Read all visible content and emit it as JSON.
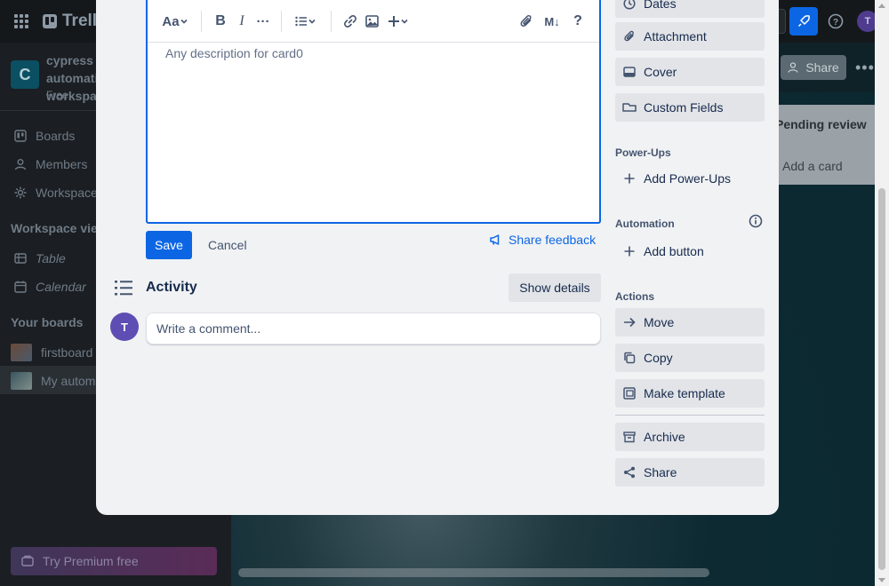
{
  "background": {
    "app_name": "Trello",
    "workspace": {
      "initial": "C",
      "name": "cypress automation workspace",
      "plan": "Free"
    },
    "nav": [
      {
        "label": "Boards",
        "icon": "board-icon"
      },
      {
        "label": "Members",
        "icon": "person-icon"
      },
      {
        "label": "Workspace settings",
        "icon": "gear-icon"
      }
    ],
    "workspace_views_heading": "Workspace views",
    "views": [
      {
        "label": "Table",
        "icon": "table-icon"
      },
      {
        "label": "Calendar",
        "icon": "calendar-icon"
      }
    ],
    "your_boards_heading": "Your boards",
    "boards": [
      {
        "label": "firstboard"
      },
      {
        "label": "My automation board"
      }
    ],
    "premium_label": "Try Premium free",
    "share_label": "Share",
    "list_title": "Pending review",
    "add_card_label": "Add a card",
    "user_initial": "T"
  },
  "card": {
    "description_text": "Any description for card0",
    "save_label": "Save",
    "cancel_label": "Cancel",
    "share_feedback_label": "Share feedback",
    "activity_title": "Activity",
    "show_details_label": "Show details",
    "comment_placeholder": "Write a comment...",
    "user_initial": "T"
  },
  "toolbar": {
    "text_style": "Aa",
    "bold": "B",
    "italic": "I",
    "more": "···",
    "markdown": "M↓",
    "help": "?"
  },
  "sidebar": {
    "add_to_card": [
      {
        "label": "Dates",
        "icon": "clock-icon"
      },
      {
        "label": "Attachment",
        "icon": "paperclip-icon"
      },
      {
        "label": "Cover",
        "icon": "cover-icon"
      },
      {
        "label": "Custom Fields",
        "icon": "custom-fields-icon"
      }
    ],
    "power_ups_heading": "Power-Ups",
    "add_power_ups_label": "Add Power-Ups",
    "automation_heading": "Automation",
    "add_button_label": "Add button",
    "actions_heading": "Actions",
    "actions": [
      {
        "label": "Move",
        "icon": "arrow-right-icon"
      },
      {
        "label": "Copy",
        "icon": "copy-icon"
      },
      {
        "label": "Make template",
        "icon": "template-icon"
      }
    ],
    "archive_label": "Archive",
    "share_label": "Share"
  }
}
